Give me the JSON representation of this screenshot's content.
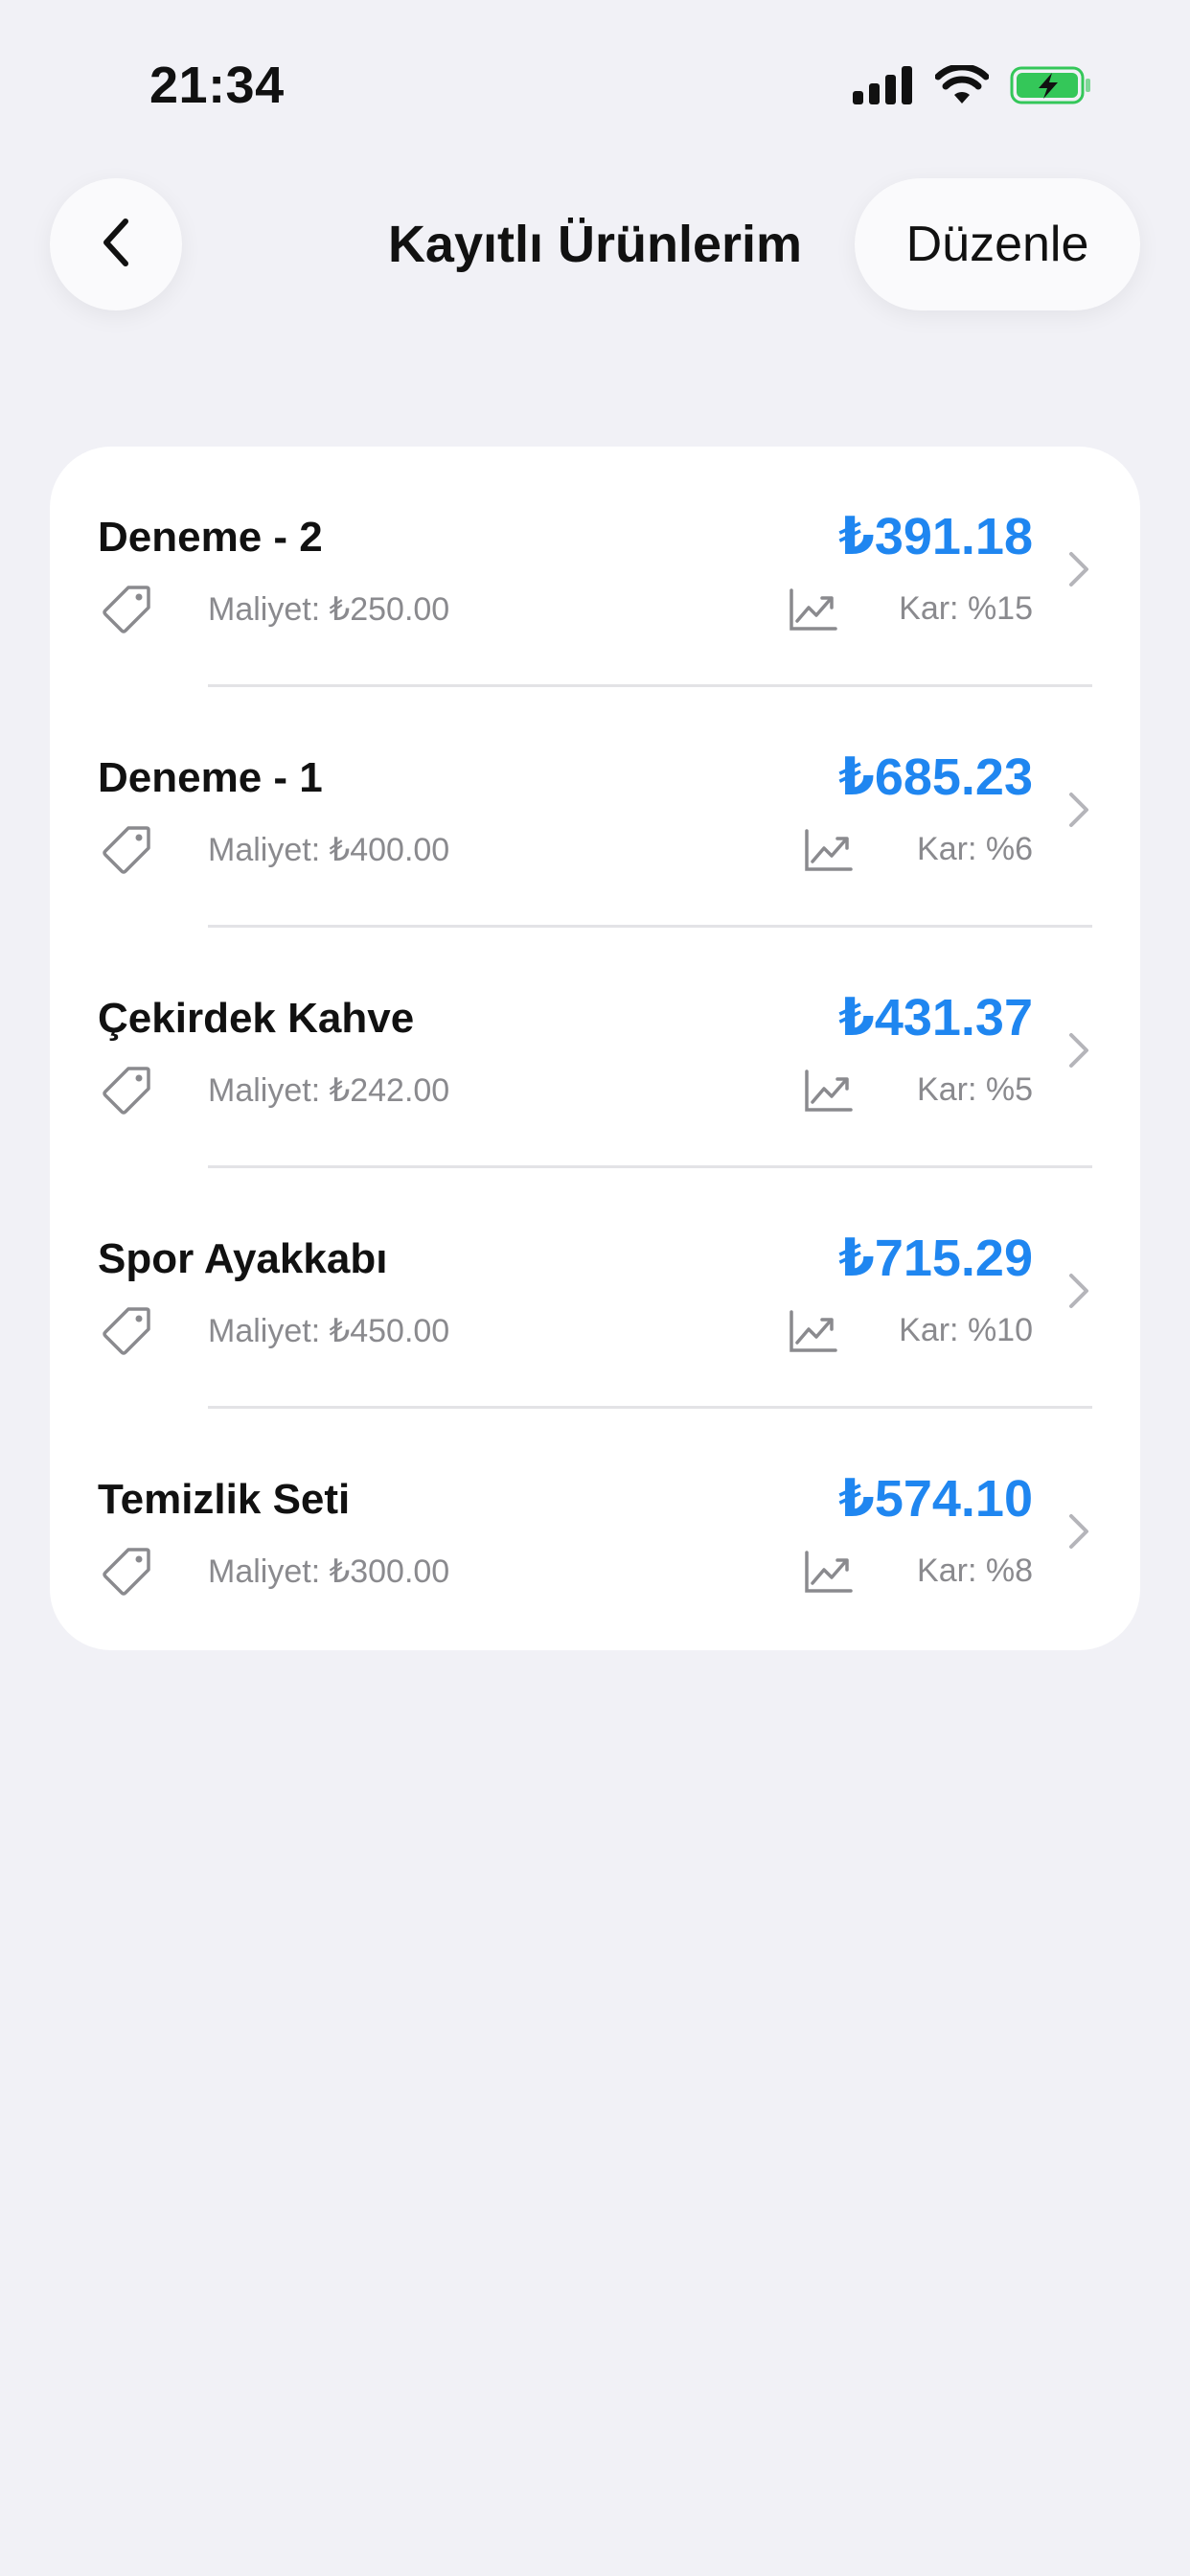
{
  "status_bar": {
    "time": "21:34"
  },
  "nav": {
    "title": "Kayıtlı Ürünlerim",
    "edit_label": "Düzenle"
  },
  "colors": {
    "accent": "#1f86f0",
    "secondary_text": "#8a8a8e",
    "background": "#f1f1f6",
    "battery": "#34c759"
  },
  "products": [
    {
      "name": "Deneme - 2",
      "price": "₺391.18",
      "cost": "Maliyet: ₺250.00",
      "profit": "Kar: %15"
    },
    {
      "name": "Deneme - 1",
      "price": "₺685.23",
      "cost": "Maliyet: ₺400.00",
      "profit": "Kar: %6"
    },
    {
      "name": "Çekirdek Kahve",
      "price": "₺431.37",
      "cost": "Maliyet: ₺242.00",
      "profit": "Kar: %5"
    },
    {
      "name": "Spor Ayakkabı",
      "price": "₺715.29",
      "cost": "Maliyet: ₺450.00",
      "profit": "Kar: %10"
    },
    {
      "name": "Temizlik Seti",
      "price": "₺574.10",
      "cost": "Maliyet: ₺300.00",
      "profit": "Kar: %8"
    }
  ],
  "icons": {
    "back": "chevron-left-icon",
    "tag": "tag-icon",
    "chart": "chart-trend-icon",
    "row_chevron": "chevron-right-icon"
  }
}
